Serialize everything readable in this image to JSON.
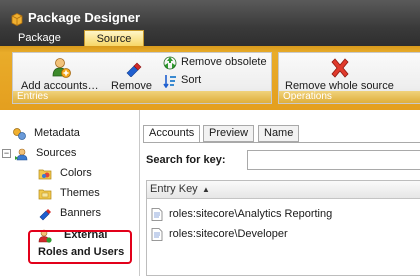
{
  "window": {
    "title": "Package Designer",
    "icon": "package-icon"
  },
  "ribbon": {
    "tabs": [
      {
        "label": "Package",
        "active": false
      },
      {
        "label": "Source",
        "active": true
      }
    ],
    "groups": {
      "entries": {
        "label": "Entries",
        "buttons": {
          "add_accounts": {
            "label": "Add accounts…",
            "icon": "add-user-icon"
          },
          "remove": {
            "label": "Remove",
            "icon": "remove-user-icon"
          },
          "remove_obsolete": {
            "label": "Remove obsolete",
            "icon": "recycle-icon"
          },
          "sort": {
            "label": "Sort",
            "icon": "sort-icon"
          }
        }
      },
      "operations": {
        "label": "Operations",
        "buttons": {
          "remove_whole_source": {
            "label": "Remove whole source",
            "icon": "red-x-icon"
          }
        }
      }
    }
  },
  "tree": {
    "metadata": {
      "label": "Metadata",
      "icon": "metadata-icon"
    },
    "sources": {
      "label": "Sources",
      "icon": "sources-icon",
      "expander": "−"
    },
    "children": [
      {
        "label": "Colors",
        "icon": "colors-folder-icon"
      },
      {
        "label": "Themes",
        "icon": "themes-folder-icon"
      },
      {
        "label": "Banners",
        "icon": "banners-icon"
      },
      {
        "label_line1": "External",
        "label_line2": "Roles and Users",
        "icon": "external-users-icon"
      }
    ]
  },
  "main": {
    "tabs": [
      {
        "label": "Accounts",
        "active": true
      },
      {
        "label": "Preview",
        "active": false
      },
      {
        "label": "Name",
        "active": false
      }
    ],
    "search": {
      "label": "Search for key:",
      "value": ""
    },
    "grid": {
      "column_header": "Entry Key",
      "sort_direction": "ascending",
      "rows": [
        {
          "key": "roles:sitecore\\Analytics Reporting",
          "icon": "document-icon"
        },
        {
          "key": "roles:sitecore\\Developer",
          "icon": "document-icon"
        }
      ]
    }
  },
  "colors": {
    "ribbon_orange": "#e49f1f",
    "title_dark": "#3a3a3a",
    "highlight_red": "#e2001a"
  }
}
